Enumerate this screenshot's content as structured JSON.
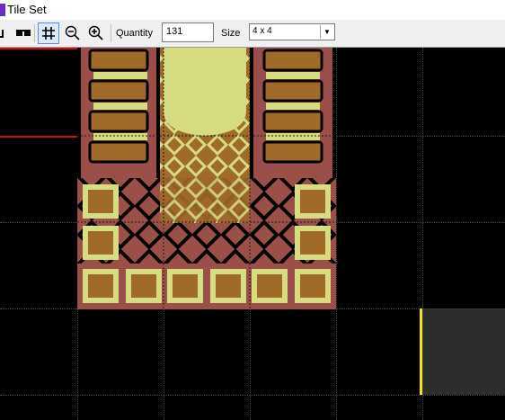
{
  "window": {
    "title": "Tile Set"
  },
  "toolbar": {
    "tools": [
      {
        "name": "flip-icon",
        "active": false
      },
      {
        "name": "glasses-icon",
        "active": false
      },
      {
        "name": "grid-icon",
        "active": true
      },
      {
        "name": "zoom-out-icon",
        "active": false
      },
      {
        "name": "zoom-in-icon",
        "active": false
      }
    ],
    "quantity_label": "Quantity",
    "quantity_value": "131",
    "size_label": "Size",
    "size_value": "4 x 4"
  },
  "colors": {
    "background": "#000000",
    "brick": "#9a5048",
    "sand": "#a06a28",
    "pale": "#d8dc80",
    "outline": "#000000",
    "selection": "#d01010",
    "cursor": "#f0e020"
  }
}
